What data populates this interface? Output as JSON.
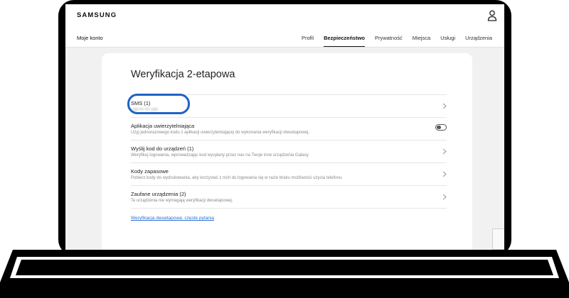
{
  "header": {
    "logo": "SAMSUNG",
    "account_icon": "person-icon"
  },
  "subnav": {
    "title": "Moje konto",
    "tabs": [
      {
        "label": "Profil",
        "active": false
      },
      {
        "label": "Bezpieczeństwo",
        "active": true
      },
      {
        "label": "Prywatność",
        "active": false
      },
      {
        "label": "Miejsca",
        "active": false
      },
      {
        "label": "Usługi",
        "active": false
      },
      {
        "label": "Urządzenia",
        "active": false
      }
    ]
  },
  "main": {
    "title": "Weryfikacja 2-etapowa",
    "options": [
      {
        "title": "SMS (1)",
        "description": "+48 ••• ••• 289",
        "blurred": true,
        "control": "chevron-right-icon"
      },
      {
        "title": "Aplikacja uwierzytelniająca",
        "description": "Użyj jednorazowego kodu z aplikacji uwierzytelniającej do wykonania weryfikacji dwuetapowej.",
        "control": "toggle",
        "toggle_on": false
      },
      {
        "title": "Wyślij kod do urządzeń (1)",
        "description": "Weryfikuj logowania, wprowadzając kod wysyłany przez nas na Twoje inne urządzenia Galaxy.",
        "control": "chevron-right-icon"
      },
      {
        "title": "Kody zapasowe",
        "description": "Pobierz kody do wydrukowania, aby korzystać z nich do logowania się w razie braku możliwości użycia telefonu.",
        "control": "chevron-right-icon"
      },
      {
        "title": "Zaufane urządzenia (2)",
        "description": "Te urządzenia nie wymagają weryfikacji dwuetapowej.",
        "control": "chevron-right-icon"
      }
    ],
    "faq_link": "Weryfikacja dwuetapowa: częste pytania"
  },
  "colors": {
    "highlight": "#1f63c5",
    "link": "#2a6fd6",
    "page_bg": "#f1f1f1"
  }
}
